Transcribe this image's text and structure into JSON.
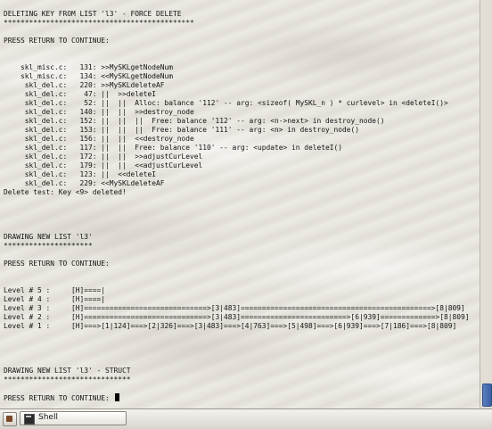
{
  "terminal": {
    "lines": [
      "DELETING KEY FROM LIST 'l3' - FORCE DELETE",
      "*********************************************",
      "",
      "PRESS RETURN TO CONTINUE:",
      "",
      "",
      "    skl_misc.c:   131: >>MySKLgetNodeNum",
      "    skl_misc.c:   134: <<MySKLgetNodeNum",
      "     skl_del.c:   220: >>MySKLdeleteAF",
      "     skl_del.c:    47: ||  >>deleteI",
      "     skl_del.c:    52: ||  ||  Alloc: balance '112' -- arg: <sizeof( MySKL_n ) * curlevel> in <deleteI()>",
      "     skl_del.c:   140: ||  ||  >>destroy_node",
      "     skl_del.c:   152: ||  ||  ||  Free: balance '112' -- arg: <n->next> in destroy_node()",
      "     skl_del.c:   153: ||  ||  ||  Free: balance '111' -- arg: <n> in destroy_node()",
      "     skl_del.c:   156: ||  ||  <<destroy_node",
      "     skl_del.c:   117: ||  ||  Free: balance '110' -- arg: <update> in deleteI()",
      "     skl_del.c:   172: ||  ||  >>adjustCurLevel",
      "     skl_del.c:   179: ||  ||  <<adjustCurLevel",
      "     skl_del.c:   123: ||  <<deleteI",
      "     skl_del.c:   229: <<MySKLdeleteAF",
      "Delete test: Key <9> deleted!",
      "",
      "",
      "",
      "",
      "DRAWING NEW LIST 'l3'",
      "*********************",
      "",
      "PRESS RETURN TO CONTINUE:",
      "",
      "",
      "Level # 5 :     [H]====|",
      "Level # 4 :     [H]====|",
      "Level # 3 :     [H]=============================>[3|483]=============================================>[8|809]",
      "Level # 2 :     [H]=============================>[3|483]=========================>[6|939]=============>[8|809]",
      "Level # 1 :     [H]===>[1|124]===>[2|326]===>[3|483]===>[4|763]===>[5|498]===>[6|939]===>[7|186]===>[8|809]",
      "",
      "",
      "",
      "",
      "DRAWING NEW LIST 'l3' - STRUCT",
      "******************************",
      "",
      "PRESS RETURN TO CONTINUE: "
    ]
  },
  "taskbar": {
    "task_label": "Shell"
  }
}
